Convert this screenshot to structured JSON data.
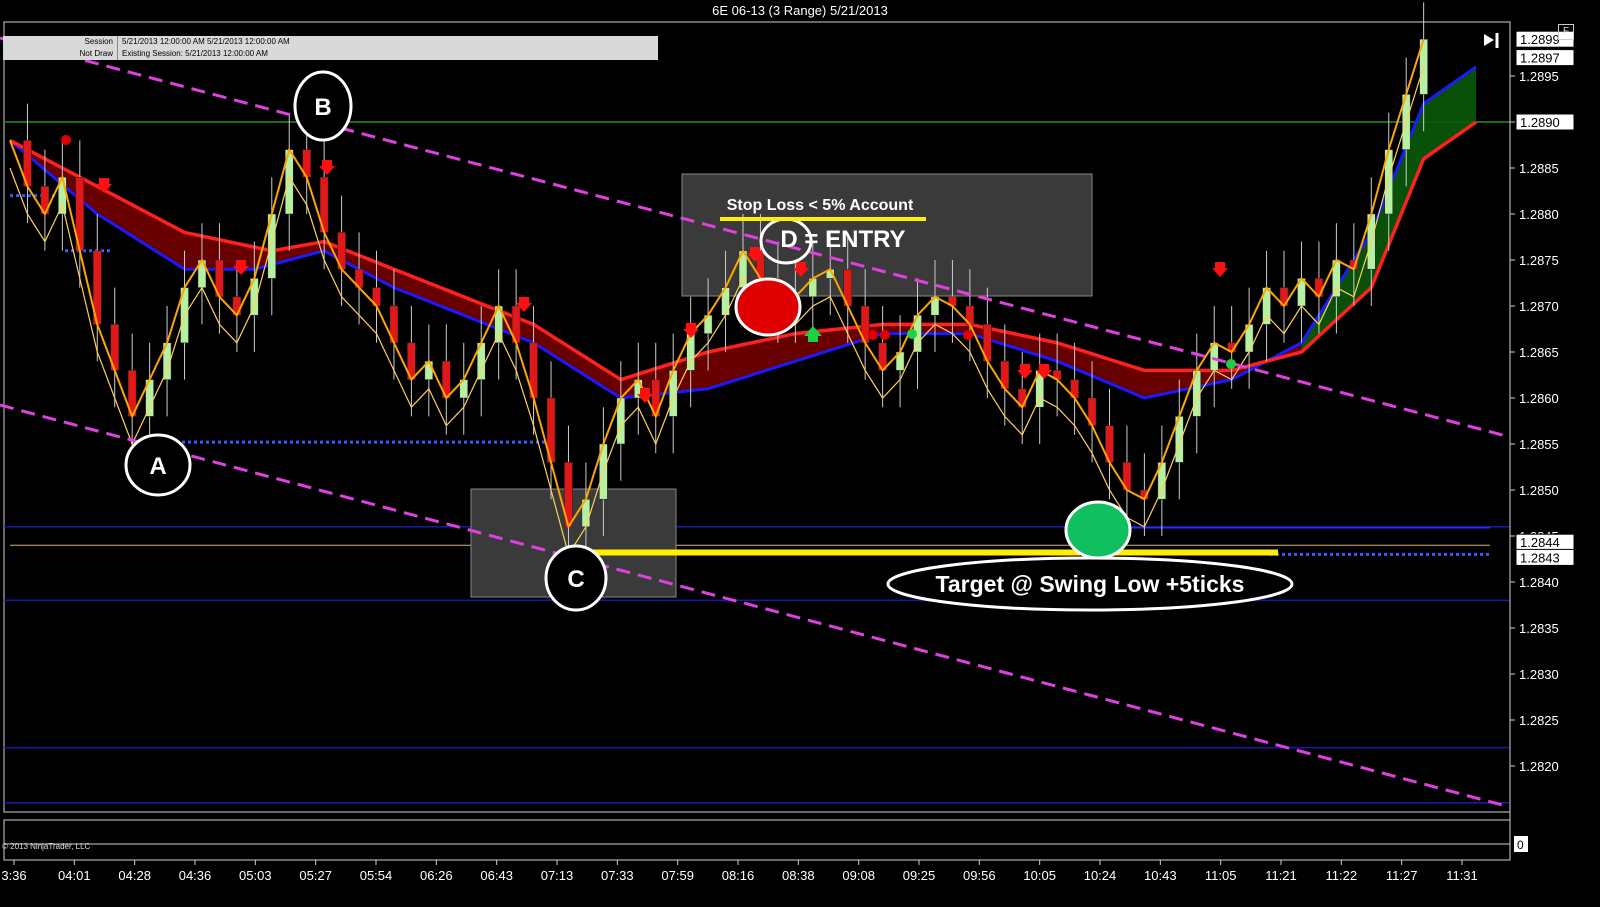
{
  "window": {
    "title": "6E 06-13 (3 Range)  5/21/2013",
    "corner_button": "F"
  },
  "info_box": {
    "rows": [
      {
        "key": "Session",
        "value": "5/21/2013 12:00:00 AM 5/21/2013 12:00:00 AM"
      },
      {
        "key": "Not Draw",
        "value": "Existing Session: 5/21/2013 12:00:00 AM"
      }
    ]
  },
  "copyright": "© 2013 NinjaTrader, LLC",
  "colors": {
    "background": "#000000",
    "candle_up": "#b6f0a0",
    "candle_down": "#e01818",
    "ema_fast": "#ff2020",
    "ema_slow": "#1a1aff",
    "ribbon_bear": "#7a0000",
    "ribbon_bull": "#0a5a0a",
    "trendline": "#e040e0",
    "target_line": "#ffee00",
    "fast_line": "#ffa500",
    "level_line": "#1a1aaa"
  },
  "chart_data": {
    "type": "candlestick",
    "instrument": "6E 06-13 (3 Range)",
    "date": "5/21/2013",
    "x_tick_labels": [
      "3:36",
      "04:01",
      "04:28",
      "04:36",
      "05:03",
      "05:27",
      "05:54",
      "06:26",
      "06:43",
      "07:13",
      "07:33",
      "07:59",
      "08:16",
      "08:38",
      "09:08",
      "09:25",
      "09:56",
      "10:05",
      "10:24",
      "10:43",
      "11:05",
      "11:21",
      "11:22",
      "11:27",
      "11:31"
    ],
    "y_tick_labels": [
      "1.2895",
      "1.2890",
      "1.2885",
      "1.2880",
      "1.2875",
      "1.2870",
      "1.2865",
      "1.2860",
      "1.2855",
      "1.2850",
      "1.2845",
      "1.2840",
      "1.2835",
      "1.2830",
      "1.2825",
      "1.2820"
    ],
    "ylim": [
      1.2815,
      1.29
    ],
    "price_labels": [
      {
        "value": 1.2899,
        "label": "1.2899"
      },
      {
        "value": 1.2897,
        "label": "1.2897"
      },
      {
        "value": 1.289,
        "label": "1.2890"
      },
      {
        "value": 1.2844,
        "label": "1.2844"
      },
      {
        "value": 1.2843,
        "label": "1.2843"
      }
    ],
    "lower_pane_label": "0",
    "price_path": [
      [
        0,
        1.2888
      ],
      [
        1,
        1.2883
      ],
      [
        2,
        1.288
      ],
      [
        3,
        1.2884
      ],
      [
        4,
        1.2876
      ],
      [
        5,
        1.2868
      ],
      [
        6,
        1.2863
      ],
      [
        7,
        1.2858
      ],
      [
        8,
        1.2862
      ],
      [
        9,
        1.2866
      ],
      [
        10,
        1.2872
      ],
      [
        11,
        1.2875
      ],
      [
        12,
        1.2871
      ],
      [
        13,
        1.2869
      ],
      [
        14,
        1.2873
      ],
      [
        15,
        1.288
      ],
      [
        16,
        1.2887
      ],
      [
        17,
        1.2884
      ],
      [
        18,
        1.2878
      ],
      [
        19,
        1.2874
      ],
      [
        20,
        1.2872
      ],
      [
        21,
        1.287
      ],
      [
        22,
        1.2866
      ],
      [
        23,
        1.2862
      ],
      [
        24,
        1.2864
      ],
      [
        25,
        1.286
      ],
      [
        26,
        1.2862
      ],
      [
        27,
        1.2866
      ],
      [
        28,
        1.287
      ],
      [
        29,
        1.2866
      ],
      [
        30,
        1.286
      ],
      [
        31,
        1.2853
      ],
      [
        32,
        1.2846
      ],
      [
        33,
        1.2849
      ],
      [
        34,
        1.2855
      ],
      [
        35,
        1.286
      ],
      [
        36,
        1.2862
      ],
      [
        37,
        1.2858
      ],
      [
        38,
        1.2863
      ],
      [
        39,
        1.2867
      ],
      [
        40,
        1.2869
      ],
      [
        41,
        1.2872
      ],
      [
        42,
        1.2876
      ],
      [
        43,
        1.2873
      ],
      [
        44,
        1.287
      ],
      [
        45,
        1.2871
      ],
      [
        46,
        1.2873
      ],
      [
        47,
        1.2874
      ],
      [
        48,
        1.287
      ],
      [
        49,
        1.2866
      ],
      [
        50,
        1.2863
      ],
      [
        51,
        1.2865
      ],
      [
        52,
        1.2869
      ],
      [
        53,
        1.2871
      ],
      [
        54,
        1.287
      ],
      [
        55,
        1.2868
      ],
      [
        56,
        1.2864
      ],
      [
        57,
        1.2861
      ],
      [
        58,
        1.2859
      ],
      [
        59,
        1.2863
      ],
      [
        60,
        1.2862
      ],
      [
        61,
        1.286
      ],
      [
        62,
        1.2857
      ],
      [
        63,
        1.2853
      ],
      [
        64,
        1.285
      ],
      [
        65,
        1.2849
      ],
      [
        66,
        1.2853
      ],
      [
        67,
        1.2858
      ],
      [
        68,
        1.2863
      ],
      [
        69,
        1.2866
      ],
      [
        70,
        1.2865
      ],
      [
        71,
        1.2868
      ],
      [
        72,
        1.2872
      ],
      [
        73,
        1.287
      ],
      [
        74,
        1.2873
      ],
      [
        75,
        1.2871
      ],
      [
        76,
        1.2875
      ],
      [
        77,
        1.2874
      ],
      [
        78,
        1.288
      ],
      [
        79,
        1.2887
      ],
      [
        80,
        1.2893
      ],
      [
        81,
        1.2899
      ]
    ],
    "ema_red": [
      [
        0,
        1.2888
      ],
      [
        5,
        1.2883
      ],
      [
        10,
        1.2878
      ],
      [
        15,
        1.2876
      ],
      [
        18,
        1.2877
      ],
      [
        22,
        1.2874
      ],
      [
        26,
        1.2871
      ],
      [
        30,
        1.2868
      ],
      [
        35,
        1.2862
      ],
      [
        40,
        1.2865
      ],
      [
        45,
        1.2867
      ],
      [
        50,
        1.2868
      ],
      [
        55,
        1.2868
      ],
      [
        60,
        1.2866
      ],
      [
        65,
        1.2863
      ],
      [
        70,
        1.2863
      ],
      [
        74,
        1.2865
      ],
      [
        78,
        1.2872
      ],
      [
        81,
        1.2886
      ],
      [
        84,
        1.289
      ]
    ],
    "ema_blue": [
      [
        0,
        1.2888
      ],
      [
        5,
        1.288
      ],
      [
        10,
        1.2874
      ],
      [
        14,
        1.2874
      ],
      [
        18,
        1.2876
      ],
      [
        22,
        1.2872
      ],
      [
        26,
        1.2869
      ],
      [
        30,
        1.2866
      ],
      [
        35,
        1.286
      ],
      [
        40,
        1.2861
      ],
      [
        45,
        1.2864
      ],
      [
        50,
        1.2867
      ],
      [
        55,
        1.2867
      ],
      [
        60,
        1.2864
      ],
      [
        65,
        1.286
      ],
      [
        70,
        1.2862
      ],
      [
        74,
        1.2866
      ],
      [
        78,
        1.2878
      ],
      [
        81,
        1.2892
      ],
      [
        84,
        1.2896
      ]
    ],
    "annotations": [
      {
        "label": "A",
        "type": "swing_low"
      },
      {
        "label": "B",
        "type": "swing_high"
      },
      {
        "label": "C",
        "type": "swing_low"
      },
      {
        "label": "D = ENTRY",
        "type": "entry"
      }
    ],
    "text_annotations": {
      "stop_loss": "Stop Loss < 5% Account",
      "target": "Target @ Swing Low +5ticks"
    },
    "target_level": 1.2843,
    "horizontal_levels": [
      1.289,
      1.2846,
      1.2838,
      1.2822,
      1.2816
    ],
    "grid": false
  }
}
